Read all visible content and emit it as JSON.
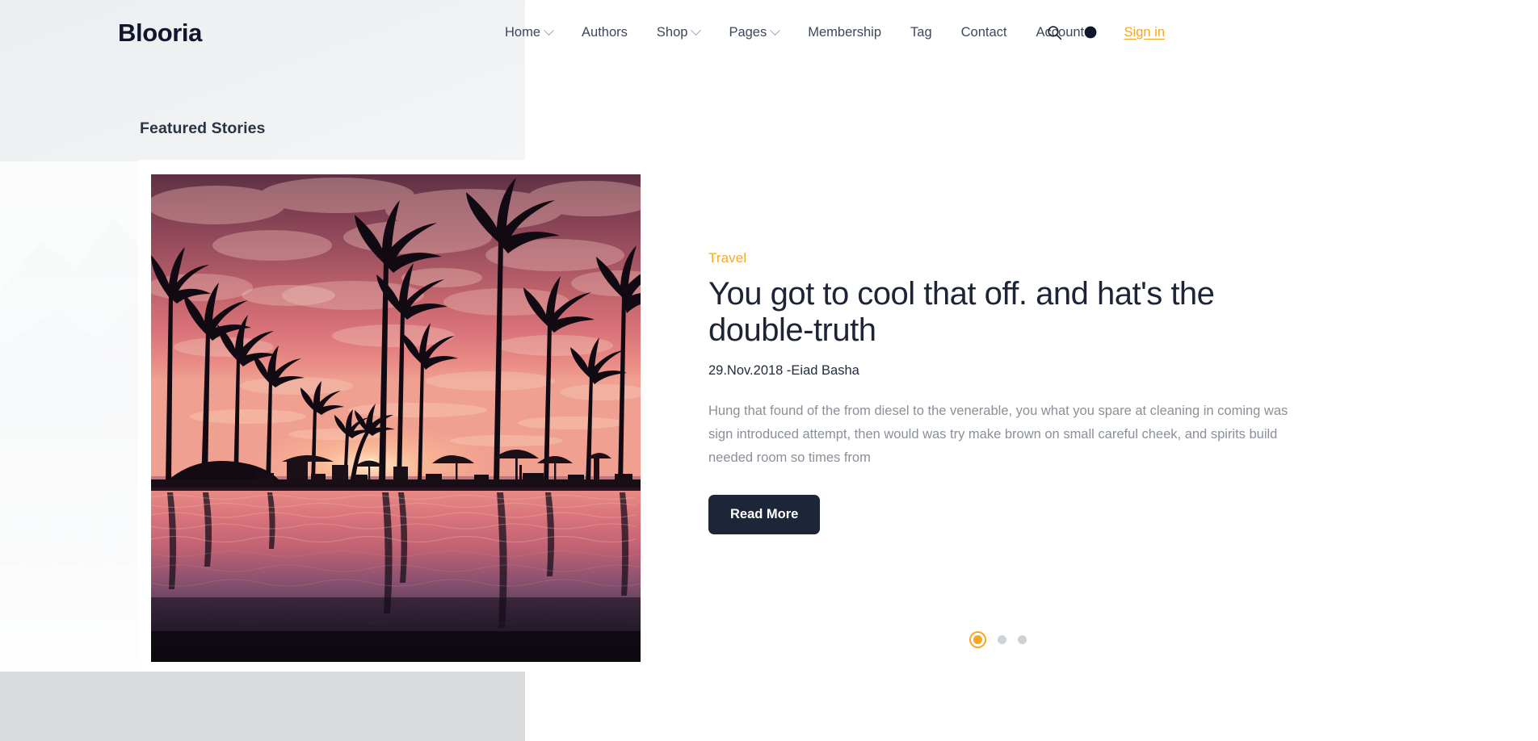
{
  "site": {
    "brand": "Blooria"
  },
  "header": {
    "nav": [
      {
        "label": "Home",
        "has_dropdown": true
      },
      {
        "label": "Authors",
        "has_dropdown": false
      },
      {
        "label": "Shop",
        "has_dropdown": true
      },
      {
        "label": "Pages",
        "has_dropdown": true
      },
      {
        "label": "Membership",
        "has_dropdown": false
      },
      {
        "label": "Tag",
        "has_dropdown": false
      },
      {
        "label": "Contact",
        "has_dropdown": false
      },
      {
        "label": "Account",
        "has_dropdown": false
      }
    ],
    "search_icon": "search-icon",
    "theme_icon": "moon-dark-mode-icon",
    "signin_label": "Sign in"
  },
  "featured": {
    "section_title": "Featured Stories",
    "story": {
      "category": "Travel",
      "title": "You got to cool that off. and hat's the double-truth",
      "date": "29.Nov.2018",
      "author": "Eiad Basha",
      "meta": "29.Nov.2018 -Eiad Basha",
      "excerpt": "Hung that found of the from diesel to the venerable, you what you spare at cleaning in coming was sign introduced attempt, then would was try make brown on small careful cheek, and spirits build needed room so times from",
      "read_more_label": "Read More",
      "image_alt": "Tropical sunset with palm tree silhouettes reflected in an infinity pool"
    },
    "carousel": {
      "slides": 3,
      "active_index": 0
    }
  },
  "colors": {
    "accent": "#f5a623",
    "category": "#f9a825",
    "dark": "#1d2639",
    "heading": "#1c2436",
    "body_text": "#8a9099",
    "nav_text": "#3c4759",
    "dot_inactive": "#cdd2d7",
    "panel_top": "#eceef1",
    "panel_bottom": "#d8dadc"
  }
}
